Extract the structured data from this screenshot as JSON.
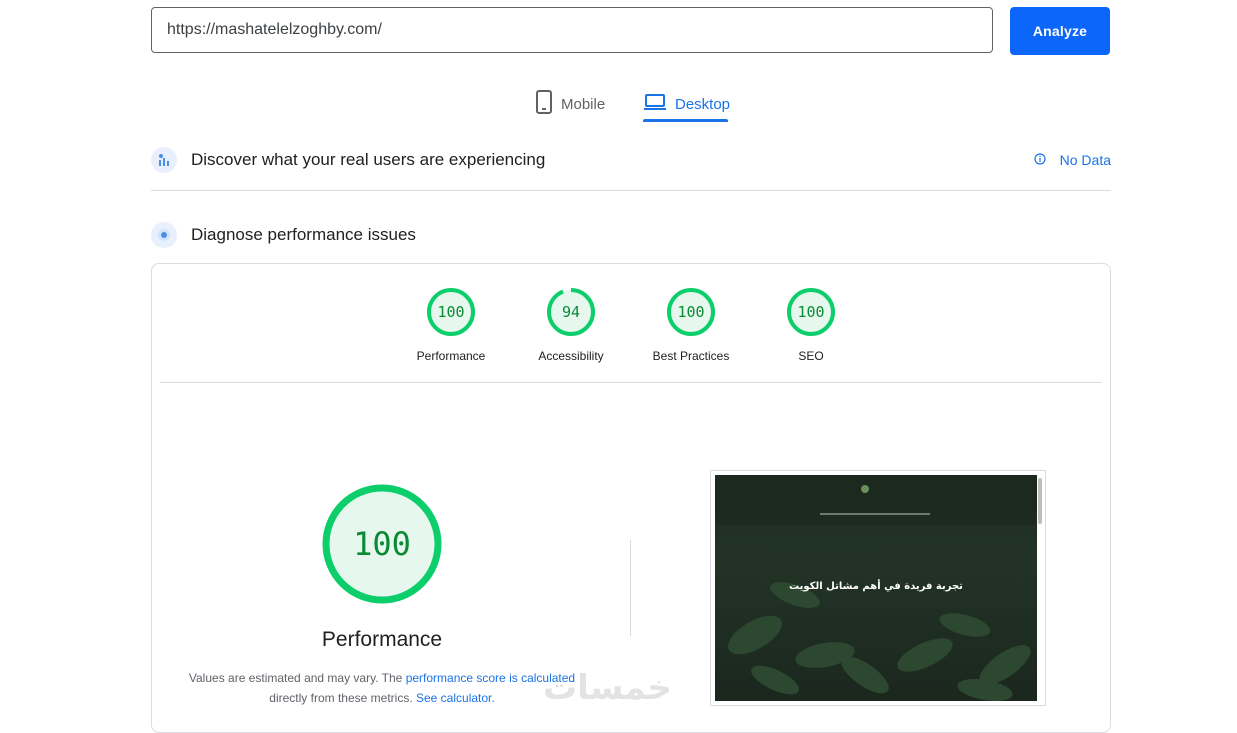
{
  "url_input": {
    "value": "https://mashatelelzoghby.com/"
  },
  "analyze_button": {
    "label": "Analyze"
  },
  "device_tabs": [
    {
      "label": "Mobile",
      "icon": "phone-icon",
      "selected": false
    },
    {
      "label": "Desktop",
      "icon": "laptop-icon",
      "selected": true
    }
  ],
  "field_data_section": {
    "title": "Discover what your real users are experiencing",
    "status": "No Data",
    "status_icon": "info-icon"
  },
  "lab_section": {
    "title": "Diagnose performance issues"
  },
  "scores": [
    {
      "value": 100,
      "label": "Performance",
      "fraction": 1.0
    },
    {
      "value": 94,
      "label": "Accessibility",
      "fraction": 0.94
    },
    {
      "value": 100,
      "label": "Best Practices",
      "fraction": 1.0
    },
    {
      "value": 100,
      "label": "SEO",
      "fraction": 1.0
    }
  ],
  "performance_detail": {
    "score": 100,
    "title": "Performance",
    "note_prefix": "Values are estimated and may vary. The",
    "note_link1": "performance score is calculated",
    "note_mid": "directly from these metrics.",
    "note_link2": "See calculator."
  },
  "screenshot": {
    "headline": "تجربة فريدة في أهم مشاتل الكويت"
  },
  "watermark": "خمسات",
  "colors": {
    "accent": "#1a73e8",
    "pass_green": "#0cce6b",
    "pass_fill": "#e6f8ee",
    "pass_text": "#0b8a35"
  }
}
